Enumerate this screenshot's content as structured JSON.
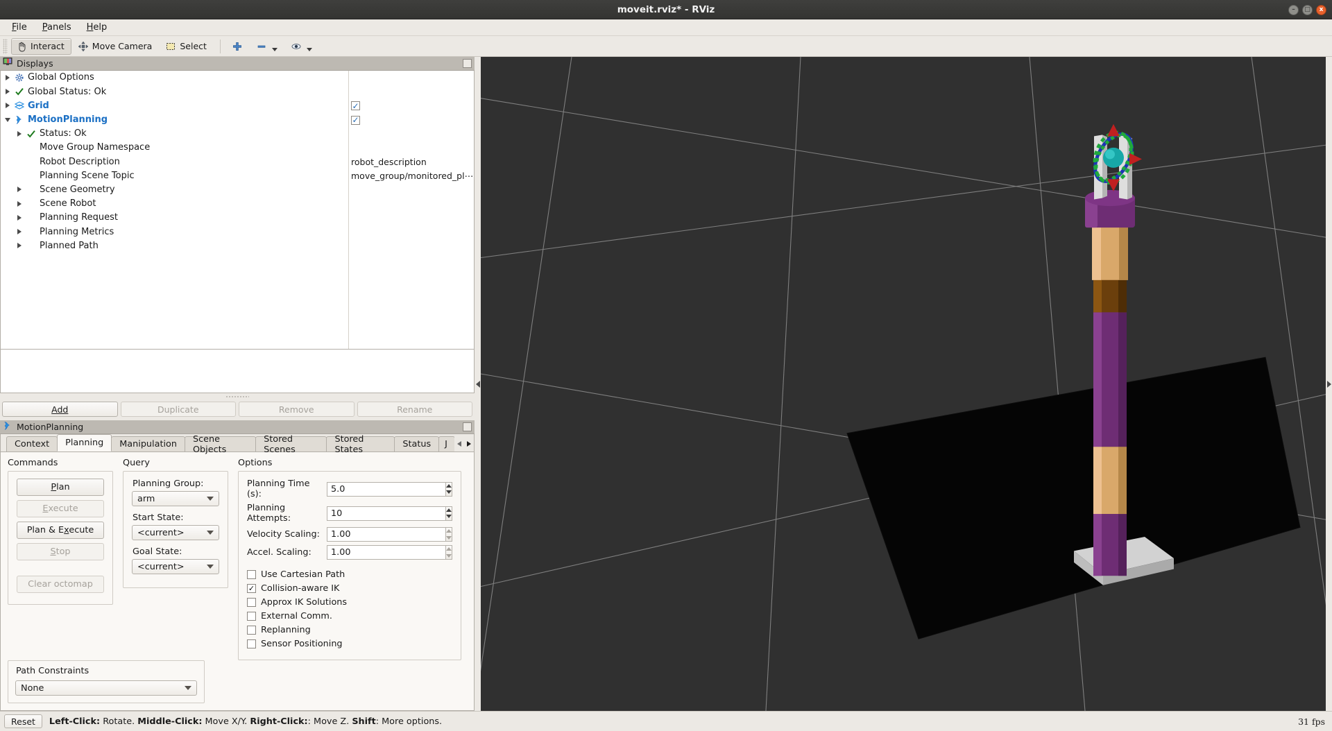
{
  "window": {
    "title": "moveit.rviz* - RViz",
    "minimize": "–",
    "maximize": "□",
    "close": "x"
  },
  "menubar": {
    "items": [
      "File",
      "Panels",
      "Help"
    ]
  },
  "toolbar": {
    "interact": "Interact",
    "move_camera": "Move Camera",
    "select": "Select",
    "focus_icon": "plus-icon",
    "measure_icon": "minus-icon",
    "goal_icon": "eye-icon"
  },
  "displays": {
    "panel_title": "Displays",
    "rows": [
      {
        "label": "Global Options",
        "indent": 0,
        "arrow": "closed",
        "icon": "gear-icon",
        "bold": false,
        "value": "",
        "checkbox": null
      },
      {
        "label": "Global Status: Ok",
        "indent": 0,
        "arrow": "closed",
        "icon": "check-icon",
        "bold": false,
        "value": "",
        "checkbox": null
      },
      {
        "label": "Grid",
        "indent": 0,
        "arrow": "closed",
        "icon": "grid-icon",
        "bold": true,
        "value": "",
        "checkbox": true
      },
      {
        "label": "MotionPlanning",
        "indent": 0,
        "arrow": "open",
        "icon": "motion-planning-icon",
        "bold": true,
        "value": "",
        "checkbox": true
      },
      {
        "label": "Status: Ok",
        "indent": 1,
        "arrow": "closed",
        "icon": "check-icon",
        "bold": false,
        "value": "",
        "checkbox": null
      },
      {
        "label": "Move Group Namespace",
        "indent": 1,
        "arrow": "none",
        "icon": "none",
        "bold": false,
        "value": "",
        "checkbox": null
      },
      {
        "label": "Robot Description",
        "indent": 1,
        "arrow": "none",
        "icon": "none",
        "bold": false,
        "value": "robot_description",
        "checkbox": null
      },
      {
        "label": "Planning Scene Topic",
        "indent": 1,
        "arrow": "none",
        "icon": "none",
        "bold": false,
        "value": "move_group/monitored_pl⋯",
        "checkbox": null
      },
      {
        "label": "Scene Geometry",
        "indent": 1,
        "arrow": "closed",
        "icon": "none",
        "bold": false,
        "value": "",
        "checkbox": null
      },
      {
        "label": "Scene Robot",
        "indent": 1,
        "arrow": "closed",
        "icon": "none",
        "bold": false,
        "value": "",
        "checkbox": null
      },
      {
        "label": "Planning Request",
        "indent": 1,
        "arrow": "closed",
        "icon": "none",
        "bold": false,
        "value": "",
        "checkbox": null
      },
      {
        "label": "Planning Metrics",
        "indent": 1,
        "arrow": "closed",
        "icon": "none",
        "bold": false,
        "value": "",
        "checkbox": null
      },
      {
        "label": "Planned Path",
        "indent": 1,
        "arrow": "closed",
        "icon": "none",
        "bold": false,
        "value": "",
        "checkbox": null
      }
    ],
    "buttons": {
      "add": "Add",
      "duplicate": "Duplicate",
      "remove": "Remove",
      "rename": "Rename"
    }
  },
  "motion_planning": {
    "panel_title": "MotionPlanning",
    "tabs": [
      {
        "label": "Context",
        "active": false
      },
      {
        "label": "Planning",
        "active": true
      },
      {
        "label": "Manipulation",
        "active": false
      },
      {
        "label": "Scene Objects",
        "active": false
      },
      {
        "label": "Stored Scenes",
        "active": false
      },
      {
        "label": "Stored States",
        "active": false
      },
      {
        "label": "Status",
        "active": false
      },
      {
        "label": "J",
        "active": false
      }
    ],
    "commands": {
      "title": "Commands",
      "plan": "Plan",
      "execute": "Execute",
      "plan_execute": "Plan & Execute",
      "stop": "Stop",
      "clear_octomap": "Clear octomap"
    },
    "query": {
      "title": "Query",
      "planning_group_label": "Planning Group:",
      "planning_group_value": "arm",
      "start_state_label": "Start State:",
      "start_state_value": "<current>",
      "goal_state_label": "Goal State:",
      "goal_state_value": "<current>"
    },
    "options": {
      "title": "Options",
      "fields": [
        {
          "label": "Planning Time (s):",
          "value": "5.0"
        },
        {
          "label": "Planning Attempts:",
          "value": "10"
        },
        {
          "label": "Velocity Scaling:",
          "value": "1.00"
        },
        {
          "label": "Accel. Scaling:",
          "value": "1.00"
        }
      ],
      "checkboxes": [
        {
          "label": "Use Cartesian Path",
          "checked": false
        },
        {
          "label": "Collision-aware IK",
          "checked": true
        },
        {
          "label": "Approx IK Solutions",
          "checked": false
        },
        {
          "label": "External Comm.",
          "checked": false
        },
        {
          "label": "Replanning",
          "checked": false
        },
        {
          "label": "Sensor Positioning",
          "checked": false
        }
      ]
    },
    "path_constraints": {
      "title": "Path Constraints",
      "value": "None"
    }
  },
  "statusbar": {
    "reset": "Reset",
    "hint_parts": [
      {
        "text": "Left-Click:",
        "bold": true
      },
      {
        "text": " Rotate. ",
        "bold": false
      },
      {
        "text": "Middle-Click:",
        "bold": true
      },
      {
        "text": " Move X/Y. ",
        "bold": false
      },
      {
        "text": "Right-Click:",
        "bold": true
      },
      {
        "text": ": Move Z. ",
        "bold": false
      },
      {
        "text": "Shift",
        "bold": true
      },
      {
        "text": ": More options.",
        "bold": false
      }
    ],
    "fps": "31 fps"
  },
  "viewport": {
    "background_color": "#303030",
    "ground_color": "#050505",
    "grid_color": "#8e8e8e",
    "robot_colors": {
      "purple": "#6e2d74",
      "tan": "#d9a86a",
      "brown": "#6b3f0c",
      "gray": "#c8c8c8",
      "marker_teal": "#17a8a8",
      "marker_green": "#1faa3c",
      "marker_blue": "#1c34b4",
      "marker_red": "#c02020"
    }
  }
}
